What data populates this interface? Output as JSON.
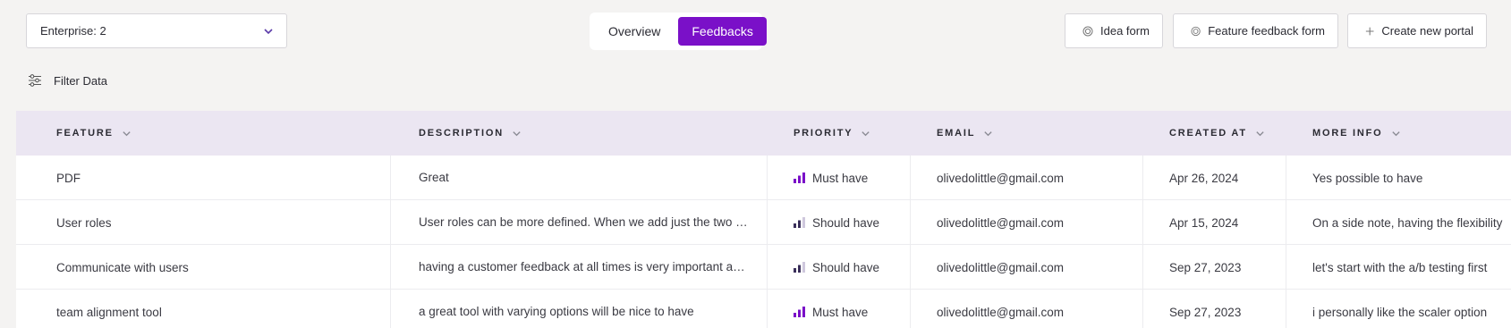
{
  "toolbar": {
    "enterprise_select": "Enterprise: 2",
    "tabs": [
      {
        "label": "Overview",
        "active": false
      },
      {
        "label": "Feedbacks",
        "active": true
      }
    ],
    "idea_form": "Idea form",
    "feature_feedback_form": "Feature feedback form",
    "create_portal": "Create new portal",
    "filter": "Filter Data"
  },
  "colors": {
    "accent": "#7a10c8",
    "header_bg": "#ebe6f2",
    "page_bg": "#f4f3f2"
  },
  "table": {
    "columns": [
      "FEATURE",
      "DESCRIPTION",
      "PRIORITY",
      "EMAIL",
      "CREATED AT",
      "MORE INFO"
    ],
    "rows": [
      {
        "feature": "PDF",
        "description": "Great",
        "priority": "Must have",
        "priority_icon": "priority-bars-3",
        "email": "olivedolittle@gmail.com",
        "created_at": "Apr 26, 2024",
        "more_info": "Yes possible to have"
      },
      {
        "feature": "User roles",
        "description": "User roles can be more defined. When we add just the two …",
        "priority": "Should have",
        "priority_icon": "priority-bars-2",
        "email": "olivedolittle@gmail.com",
        "created_at": "Apr 15, 2024",
        "more_info": "On a side note, having the flexibility"
      },
      {
        "feature": "Communicate with users",
        "description": "having a customer feedback at all times is very important a…",
        "priority": "Should have",
        "priority_icon": "priority-bars-2",
        "email": "olivedolittle@gmail.com",
        "created_at": "Sep 27, 2023",
        "more_info": "let's start with the a/b testing first"
      },
      {
        "feature": "team alignment tool",
        "description": "a great tool with varying options will be nice to have",
        "priority": "Must have",
        "priority_icon": "priority-bars-3",
        "email": "olivedolittle@gmail.com",
        "created_at": "Sep 27, 2023",
        "more_info": "i personally like the scaler option"
      }
    ]
  }
}
